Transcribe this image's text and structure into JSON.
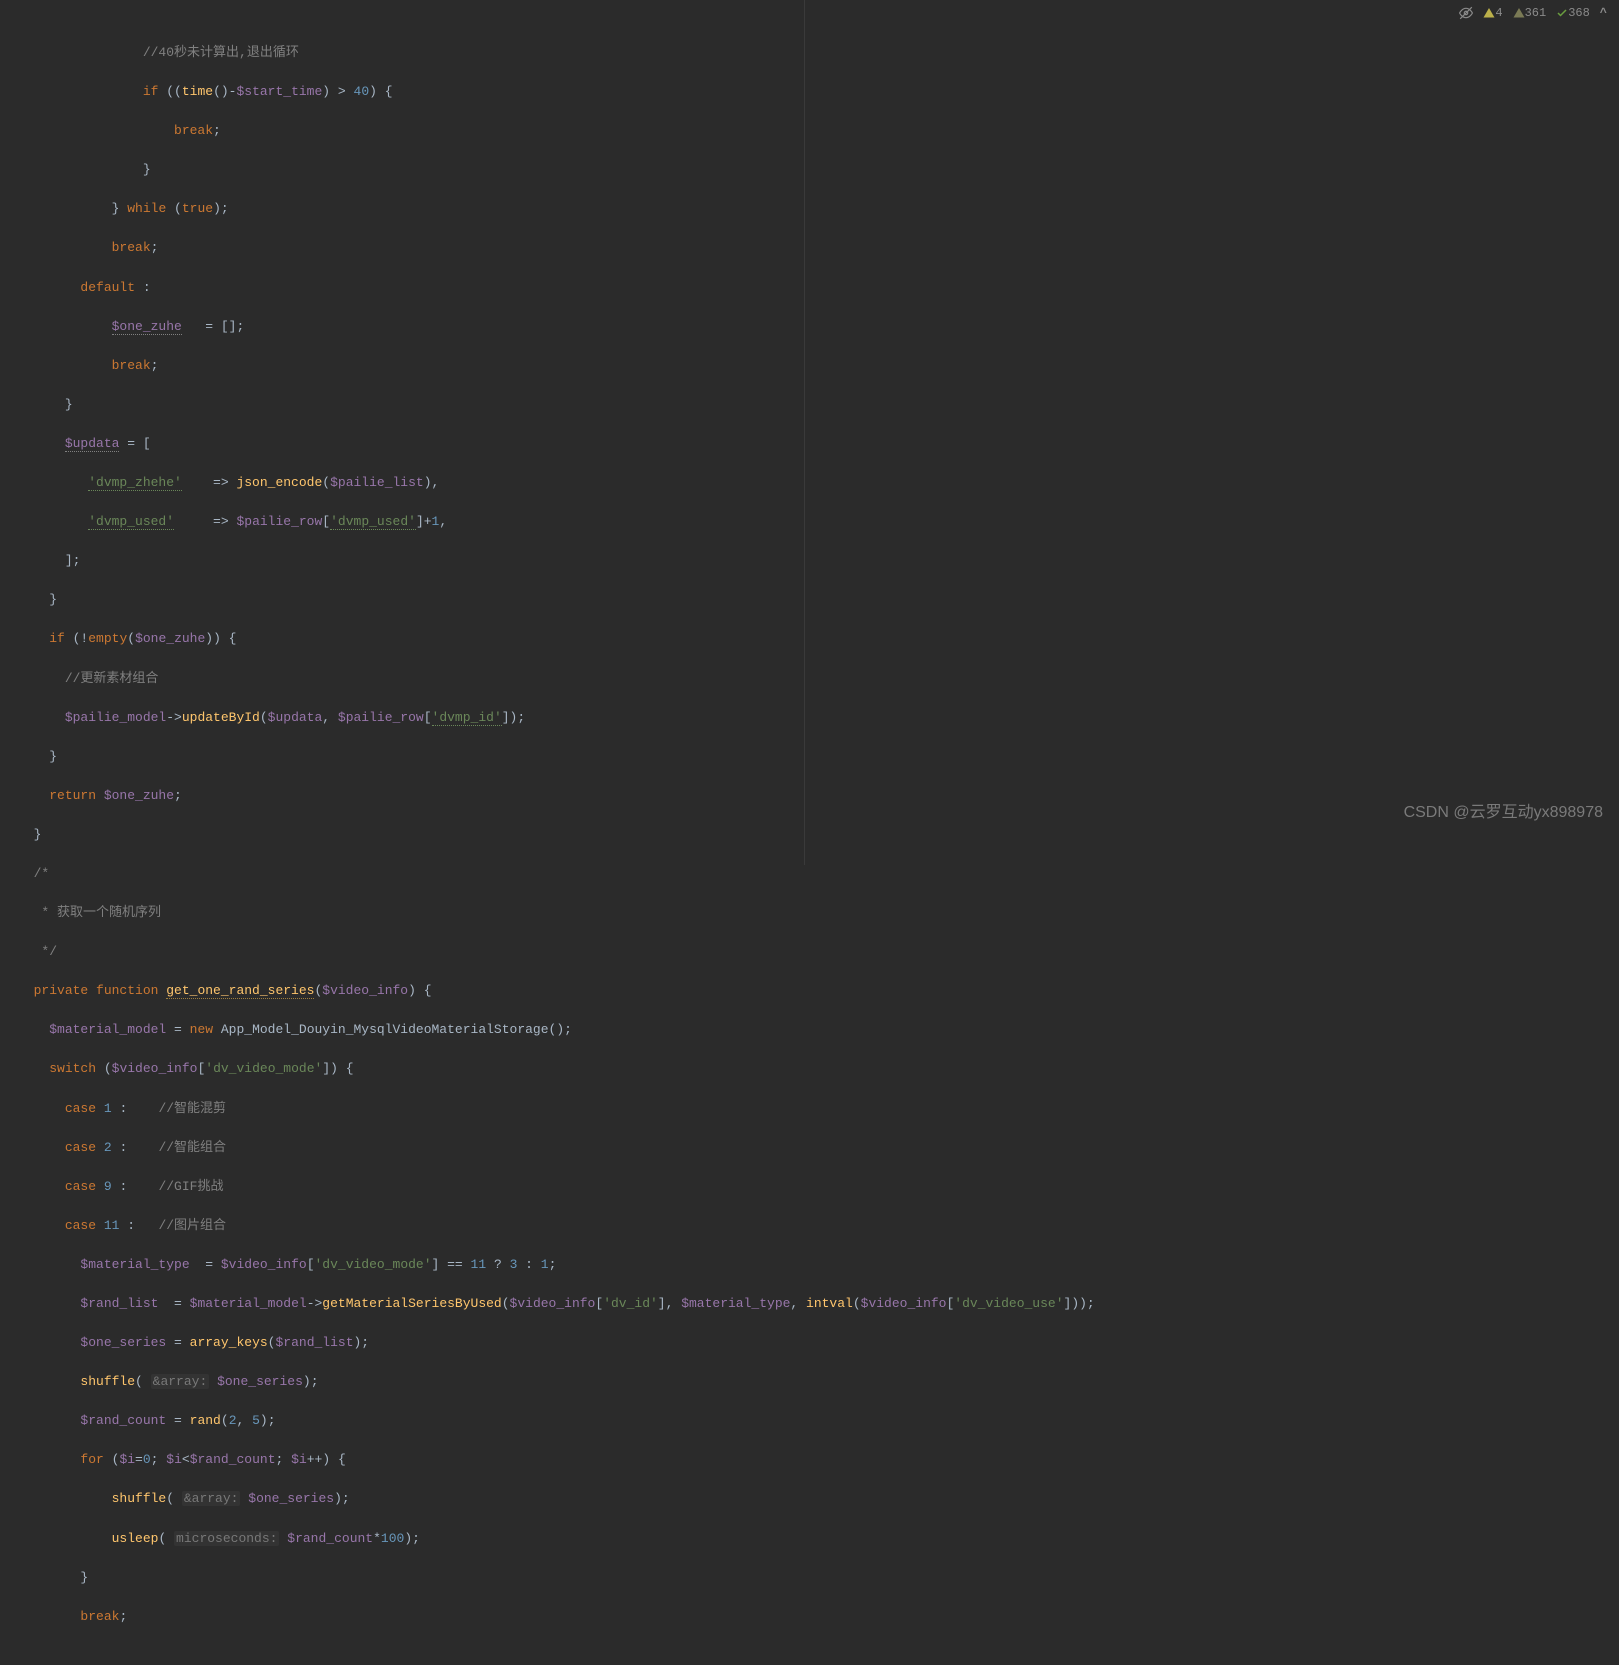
{
  "topbar": {
    "warnings1_count": "4",
    "warnings2_count": "361",
    "passed_count": "368"
  },
  "watermark": "CSDN @云罗互动yx898978",
  "code": {
    "l1": "//40秒未计算出,退出循环",
    "l2a": "if",
    "l2b": " ((",
    "l2c": "time",
    "l2d": "()-",
    "l2e": "$start_time",
    "l2f": ") > ",
    "l2g": "40",
    "l2h": ") {",
    "l3": "break",
    "l3b": ";",
    "l4": "}",
    "l5a": "} ",
    "l5b": "while",
    "l5c": " (",
    "l5d": "true",
    "l5e": ");",
    "l6a": "break",
    "l6b": ";",
    "l7a": "default",
    "l7b": " :",
    "l8a": "$one_zuhe",
    "l8b": "   = [];",
    "l9a": "break",
    "l9b": ";",
    "l10": "}",
    "l11a": "$updata",
    "l11b": " = [",
    "l12a": "'dvmp_zhehe'",
    "l12b": "    => ",
    "l12c": "json_encode",
    "l12d": "(",
    "l12e": "$pailie_list",
    "l12f": "),",
    "l13a": "'dvmp_used'",
    "l13b": "     => ",
    "l13c": "$pailie_row",
    "l13d": "[",
    "l13e": "'dvmp_used'",
    "l13f": "]+",
    "l13g": "1",
    "l13h": ",",
    "l14": "];",
    "l15": "}",
    "l16a": "if",
    "l16b": " (!",
    "l16c": "empty",
    "l16d": "(",
    "l16e": "$one_zuhe",
    "l16f": ")) {",
    "l17": "//更新素材组合",
    "l18a": "$pailie_model",
    "l18b": "->",
    "l18c": "updateById",
    "l18d": "(",
    "l18e": "$updata",
    "l18f": ", ",
    "l18g": "$pailie_row",
    "l18h": "[",
    "l18i": "'dvmp_id'",
    "l18j": "]);",
    "l19": "}",
    "l20a": "return ",
    "l20b": "$one_zuhe",
    "l20c": ";",
    "l21": "}",
    "l22": "/*",
    "l23": " * 获取一个随机序列",
    "l24": " */",
    "l25a": "private function ",
    "l25b": "get_one_rand_series",
    "l25c": "(",
    "l25d": "$video_info",
    "l25e": ") {",
    "l26a": "$material_model",
    "l26b": " = ",
    "l26c": "new ",
    "l26d": "App_Model_Douyin_MysqlVideoMaterialStorage",
    "l26e": "();",
    "l27a": "switch",
    "l27b": " (",
    "l27c": "$video_info",
    "l27d": "[",
    "l27e": "'dv_video_mode'",
    "l27f": "]) {",
    "l28a": "case ",
    "l28b": "1",
    "l28c": " :    ",
    "l28d": "//智能混剪",
    "l29a": "case ",
    "l29b": "2",
    "l29c": " :    ",
    "l29d": "//智能组合",
    "l30a": "case ",
    "l30b": "9",
    "l30c": " :    ",
    "l30d": "//GIF挑战",
    "l31a": "case ",
    "l31b": "11",
    "l31c": " :   ",
    "l31d": "//图片组合",
    "l32a": "$material_type",
    "l32b": "  = ",
    "l32c": "$video_info",
    "l32d": "[",
    "l32e": "'dv_video_mode'",
    "l32f": "] == ",
    "l32g": "11",
    "l32h": " ? ",
    "l32i": "3",
    "l32j": " : ",
    "l32k": "1",
    "l32l": ";",
    "l33a": "$rand_list",
    "l33b": "  = ",
    "l33c": "$material_model",
    "l33d": "->",
    "l33e": "getMaterialSeriesByUsed",
    "l33f": "(",
    "l33g": "$video_info",
    "l33h": "[",
    "l33i": "'dv_id'",
    "l33j": "], ",
    "l33k": "$material_type",
    "l33l": ", ",
    "l33m": "intval",
    "l33n": "(",
    "l33o": "$video_info",
    "l33p": "[",
    "l33q": "'dv_video_use'",
    "l33r": "]));",
    "l34a": "$one_series",
    "l34b": " = ",
    "l34c": "array_keys",
    "l34d": "(",
    "l34e": "$rand_list",
    "l34f": ");",
    "l35a": "shuffle",
    "l35b": "( ",
    "l35c": "&array:",
    "l35d": " ",
    "l35e": "$one_series",
    "l35f": ");",
    "l36a": "$rand_count",
    "l36b": " = ",
    "l36c": "rand",
    "l36d": "(",
    "l36e": "2",
    "l36f": ", ",
    "l36g": "5",
    "l36h": ");",
    "l37a": "for",
    "l37b": " (",
    "l37c": "$i",
    "l37d": "=",
    "l37e": "0",
    "l37f": "; ",
    "l37g": "$i",
    "l37h": "<",
    "l37i": "$rand_count",
    "l37j": "; ",
    "l37k": "$i",
    "l37l": "++) {",
    "l38a": "shuffle",
    "l38b": "( ",
    "l38c": "&array:",
    "l38d": " ",
    "l38e": "$one_series",
    "l38f": ");",
    "l39a": "usleep",
    "l39b": "( ",
    "l39c": "microseconds:",
    "l39d": " ",
    "l39e": "$rand_count",
    "l39f": "*",
    "l39g": "100",
    "l39h": ");",
    "l40": "}",
    "l41a": "break",
    "l41b": ";"
  }
}
